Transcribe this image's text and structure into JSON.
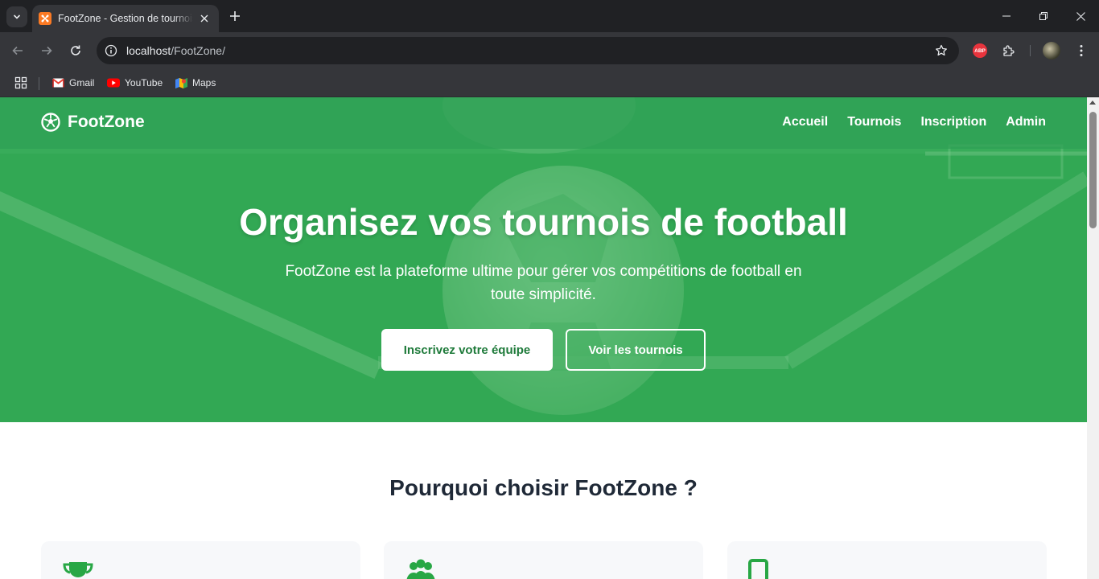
{
  "browser": {
    "tab": {
      "title": "FootZone - Gestion de tournois de football"
    },
    "address": {
      "host": "localhost",
      "path": "/FootZone/"
    },
    "bookmarks": [
      {
        "label": "Gmail",
        "icon": "gmail-icon"
      },
      {
        "label": "YouTube",
        "icon": "youtube-icon"
      },
      {
        "label": "Maps",
        "icon": "maps-icon"
      }
    ],
    "extensions": {
      "abp_label": "ABP"
    }
  },
  "site": {
    "brand": "FootZone",
    "nav": [
      "Accueil",
      "Tournois",
      "Inscription",
      "Admin"
    ]
  },
  "hero": {
    "title": "Organisez vos tournois de football",
    "subtitle": "FootZone est la plateforme ultime pour gérer vos compétitions de football en toute simplicité.",
    "primary_cta": "Inscrivez votre équipe",
    "secondary_cta": "Voir les tournois"
  },
  "features": {
    "title": "Pourquoi choisir FootZone ?",
    "cards": [
      {
        "icon": "trophy-icon"
      },
      {
        "icon": "users-icon"
      },
      {
        "icon": "mobile-icon"
      }
    ]
  },
  "colors": {
    "brand_green": "#28a745",
    "cta_text": "#1e7a3a",
    "heading": "#1f2937"
  }
}
